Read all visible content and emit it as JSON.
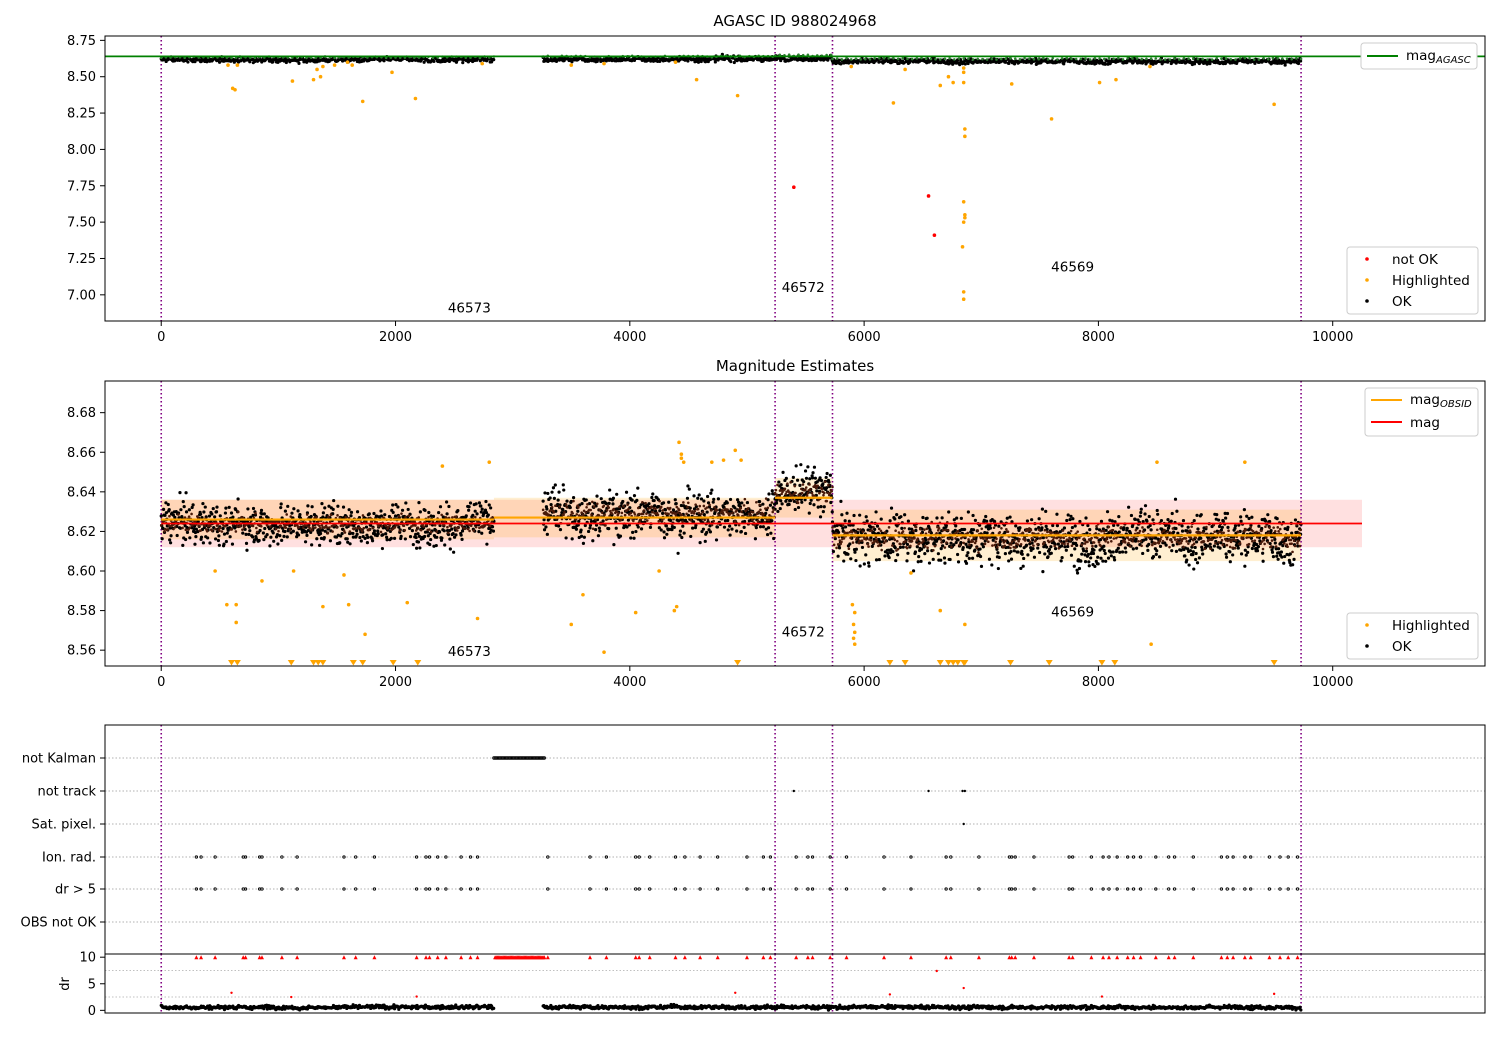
{
  "chart_data": [
    {
      "type": "scatter",
      "title": "AGASC ID 988024968",
      "xlim": [
        -480,
        11300
      ],
      "ylim": [
        6.82,
        8.78
      ],
      "xticks": [
        0,
        2000,
        4000,
        6000,
        8000,
        10000
      ],
      "yticks": [
        7.0,
        7.25,
        7.5,
        7.75,
        8.0,
        8.25,
        8.5,
        8.75
      ],
      "hline": {
        "name": "mag",
        "subscript": "AGASC",
        "value": 8.64,
        "color": "#008000"
      },
      "obsid_boundaries": [
        0,
        5240,
        5730,
        9730
      ],
      "obsid_labels": [
        {
          "text": "46573",
          "x": 2630,
          "y": 6.88
        },
        {
          "text": "46572",
          "x": 5480,
          "y": 7.02
        },
        {
          "text": "46569",
          "x": 7780,
          "y": 7.16
        }
      ],
      "series": [
        {
          "name": "not OK",
          "color": "#ff0000",
          "points": [
            [
              5400,
              7.74
            ],
            [
              6550,
              7.68
            ],
            [
              6600,
              7.41
            ]
          ]
        },
        {
          "name": "Highlighted",
          "color": "#ffa500",
          "points": [
            [
              610,
              8.42
            ],
            [
              630,
              8.41
            ],
            [
              570,
              8.58
            ],
            [
              650,
              8.58
            ],
            [
              1120,
              8.47
            ],
            [
              1300,
              8.48
            ],
            [
              1330,
              8.55
            ],
            [
              1360,
              8.5
            ],
            [
              1380,
              8.57
            ],
            [
              1480,
              8.58
            ],
            [
              1590,
              8.6
            ],
            [
              1630,
              8.58
            ],
            [
              1720,
              8.33
            ],
            [
              1970,
              8.53
            ],
            [
              2170,
              8.35
            ],
            [
              2740,
              8.59
            ],
            [
              3500,
              8.58
            ],
            [
              3780,
              8.59
            ],
            [
              4390,
              8.6
            ],
            [
              4570,
              8.48
            ],
            [
              4920,
              8.37
            ],
            [
              5890,
              8.57
            ],
            [
              6250,
              8.32
            ],
            [
              6350,
              8.55
            ],
            [
              6650,
              8.44
            ],
            [
              6720,
              8.5
            ],
            [
              6760,
              8.46
            ],
            [
              6850,
              8.56
            ],
            [
              6850,
              8.53
            ],
            [
              6850,
              8.46
            ],
            [
              6860,
              8.14
            ],
            [
              6860,
              8.09
            ],
            [
              6850,
              7.64
            ],
            [
              6860,
              7.55
            ],
            [
              6860,
              7.53
            ],
            [
              6850,
              7.5
            ],
            [
              6840,
              7.33
            ],
            [
              6850,
              7.02
            ],
            [
              6850,
              6.97
            ],
            [
              7260,
              8.45
            ],
            [
              7600,
              8.21
            ],
            [
              8010,
              8.46
            ],
            [
              8150,
              8.48
            ],
            [
              8440,
              8.57
            ],
            [
              9500,
              8.31
            ]
          ]
        },
        {
          "name": "OK",
          "color": "#000000",
          "segments": [
            {
              "x0": 0,
              "x1": 2840,
              "mean": 8.617,
              "spread": 0.012
            },
            {
              "x0": 3260,
              "x1": 5240,
              "mean": 8.622,
              "spread": 0.013
            },
            {
              "x0": 5240,
              "x1": 5730,
              "mean": 8.63,
              "spread": 0.012
            },
            {
              "x0": 5730,
              "x1": 9730,
              "mean": 8.606,
              "spread": 0.013
            }
          ]
        }
      ],
      "legend": [
        {
          "entries": [
            "mag"
          ],
          "subscript": "AGASC",
          "position": "upper right"
        },
        {
          "entries": [
            "not OK",
            "Highlighted",
            "OK"
          ],
          "position": "lower right"
        }
      ]
    },
    {
      "type": "scatter",
      "title": "Magnitude Estimates",
      "xlim": [
        -480,
        11300
      ],
      "ylim": [
        8.552,
        8.696
      ],
      "xticks": [
        0,
        2000,
        4000,
        6000,
        8000,
        10000
      ],
      "yticks": [
        8.56,
        8.58,
        8.6,
        8.62,
        8.64,
        8.66,
        8.68
      ],
      "obsid_boundaries": [
        0,
        5240,
        5730,
        9730
      ],
      "mag": {
        "name": "mag",
        "value": 8.624,
        "band": [
          8.612,
          8.636
        ],
        "x0": 0,
        "x1": 10250,
        "color": "#ff0000"
      },
      "mag_obsid": [
        {
          "x0": 0,
          "x1": 2840,
          "value": 8.626,
          "band": [
            8.616,
            8.636
          ],
          "color": "#ffa500"
        },
        {
          "x0": 2840,
          "x1": 5240,
          "value": 8.627,
          "band": [
            8.617,
            8.637
          ],
          "color": "#ffa500"
        },
        {
          "x0": 5240,
          "x1": 5730,
          "value": 8.637,
          "band": [
            8.627,
            8.647
          ],
          "color": "#ffa500"
        },
        {
          "x0": 5730,
          "x1": 9730,
          "value": 8.618,
          "band": [
            8.605,
            8.631
          ],
          "color": "#ffa500"
        }
      ],
      "mag_obsid_label": {
        "name": "mag",
        "subscript": "OBSID"
      },
      "obsid_labels": [
        {
          "text": "46573",
          "x": 2630,
          "y": 8.557
        },
        {
          "text": "46572",
          "x": 5480,
          "y": 8.567
        },
        {
          "text": "46569",
          "x": 7780,
          "y": 8.577
        }
      ],
      "series": [
        {
          "name": "Highlighted",
          "color": "#ffa500",
          "points": [
            [
              460,
              8.6
            ],
            [
              560,
              8.583
            ],
            [
              640,
              8.583
            ],
            [
              640,
              8.574
            ],
            [
              860,
              8.595
            ],
            [
              1130,
              8.6
            ],
            [
              1380,
              8.582
            ],
            [
              1560,
              8.598
            ],
            [
              1600,
              8.583
            ],
            [
              1740,
              8.568
            ],
            [
              2100,
              8.584
            ],
            [
              2400,
              8.653
            ],
            [
              2700,
              8.576
            ],
            [
              2800,
              8.655
            ],
            [
              3500,
              8.573
            ],
            [
              3600,
              8.588
            ],
            [
              3780,
              8.559
            ],
            [
              4050,
              8.579
            ],
            [
              4250,
              8.6
            ],
            [
              4380,
              8.58
            ],
            [
              4400,
              8.582
            ],
            [
              4420,
              8.665
            ],
            [
              4440,
              8.659
            ],
            [
              4440,
              8.657
            ],
            [
              4460,
              8.655
            ],
            [
              4700,
              8.655
            ],
            [
              4800,
              8.656
            ],
            [
              4900,
              8.661
            ],
            [
              4950,
              8.656
            ],
            [
              5900,
              8.583
            ],
            [
              5920,
              8.579
            ],
            [
              5910,
              8.573
            ],
            [
              5920,
              8.569
            ],
            [
              5910,
              8.566
            ],
            [
              5920,
              8.563
            ],
            [
              6400,
              8.599
            ],
            [
              6650,
              8.58
            ],
            [
              6860,
              8.573
            ],
            [
              8450,
              8.563
            ],
            [
              8500,
              8.655
            ],
            [
              9250,
              8.655
            ]
          ]
        },
        {
          "name": "Highlighted (clipped)",
          "color": "#ffa500",
          "marker": "triangle",
          "points": [
            [
              600,
              8.553
            ],
            [
              650,
              8.553
            ],
            [
              1110,
              8.553
            ],
            [
              1300,
              8.553
            ],
            [
              1340,
              8.553
            ],
            [
              1380,
              8.553
            ],
            [
              1640,
              8.553
            ],
            [
              1720,
              8.553
            ],
            [
              1980,
              8.553
            ],
            [
              2190,
              8.553
            ],
            [
              4920,
              8.553
            ],
            [
              6220,
              8.553
            ],
            [
              6350,
              8.553
            ],
            [
              6650,
              8.553
            ],
            [
              6720,
              8.553
            ],
            [
              6760,
              8.553
            ],
            [
              6800,
              8.553
            ],
            [
              6850,
              8.553
            ],
            [
              6860,
              8.553
            ],
            [
              7250,
              8.553
            ],
            [
              7580,
              8.553
            ],
            [
              8030,
              8.553
            ],
            [
              8140,
              8.553
            ],
            [
              9500,
              8.553
            ]
          ]
        },
        {
          "name": "OK",
          "color": "#000000",
          "segments": [
            {
              "x0": 0,
              "x1": 2840,
              "mean": 8.624,
              "spread": 0.007
            },
            {
              "x0": 3260,
              "x1": 5240,
              "mean": 8.629,
              "spread": 0.008
            },
            {
              "x0": 5240,
              "x1": 5730,
              "mean": 8.64,
              "spread": 0.008
            },
            {
              "x0": 5730,
              "x1": 9730,
              "mean": 8.617,
              "spread": 0.009
            }
          ]
        }
      ],
      "legend": [
        {
          "entries": [
            "mag OBSID",
            "mag"
          ],
          "position": "upper right"
        },
        {
          "entries": [
            "Highlighted",
            "OK"
          ],
          "position": "lower right"
        }
      ]
    },
    {
      "type": "scatter",
      "title": "",
      "xlim": [
        -480,
        11300
      ],
      "categories": [
        "not Kalman",
        "not track",
        "Sat. pixel.",
        "Ion. rad.",
        "dr > 5",
        "OBS not OK"
      ],
      "obsid_boundaries": [
        0,
        5240,
        5730,
        9730
      ],
      "flags": {
        "not Kalman": [
          [
            2840,
            3270
          ]
        ],
        "not track": [
          [
            5400
          ],
          [
            6550
          ],
          [
            6840
          ],
          [
            6860
          ]
        ],
        "Sat. pixel.": [
          [
            6850
          ]
        ],
        "Ion. rad.": "sparse",
        "dr > 5": "sparse",
        "OBS not OK": []
      },
      "event_x": [
        300,
        340,
        460,
        700,
        720,
        840,
        860,
        1030,
        1160,
        1560,
        1660,
        1820,
        2180,
        2260,
        2290,
        2360,
        2430,
        2560,
        2640,
        2700,
        3300,
        3660,
        3800,
        4050,
        4080,
        4170,
        4390,
        4470,
        4600,
        4750,
        5000,
        5140,
        5200,
        5420,
        5520,
        5560,
        5710,
        5850,
        6170,
        6400,
        6700,
        6740,
        6980,
        7240,
        7260,
        7290,
        7450,
        7750,
        7780,
        7940,
        8040,
        8090,
        8160,
        8250,
        8300,
        8360,
        8490,
        8600,
        8650,
        8810,
        9050,
        9100,
        9150,
        9250,
        9300,
        9460,
        9550,
        9620,
        9700
      ]
    },
    {
      "type": "scatter",
      "title": "",
      "xlim": [
        -480,
        11300
      ],
      "ylim": [
        -0.5,
        10.6
      ],
      "yticks": [
        0,
        5,
        10
      ],
      "ylabel": "dr",
      "obsid_boundaries": [
        0,
        5240,
        5730,
        9730
      ],
      "series": [
        {
          "name": "dr",
          "color": "#000000",
          "segments": [
            {
              "x0": 0,
              "x1": 2840,
              "mean": 0.6,
              "spread": 0.25
            },
            {
              "x0": 3260,
              "x1": 9730,
              "mean": 0.6,
              "spread": 0.25
            }
          ]
        },
        {
          "name": "dr clipped",
          "color": "#ff0000",
          "marker": "triangle",
          "value": 10,
          "dense": [
            [
              2850,
              3270
            ]
          ]
        },
        {
          "name": "dr outliers",
          "color": "#ff0000",
          "points": [
            [
              600,
              3.3
            ],
            [
              1110,
              2.5
            ],
            [
              2180,
              2.6
            ],
            [
              4900,
              3.3
            ],
            [
              6220,
              3.0
            ],
            [
              6620,
              7.4
            ],
            [
              6850,
              4.2
            ],
            [
              8030,
              2.6
            ],
            [
              9500,
              3.1
            ]
          ]
        }
      ]
    }
  ]
}
